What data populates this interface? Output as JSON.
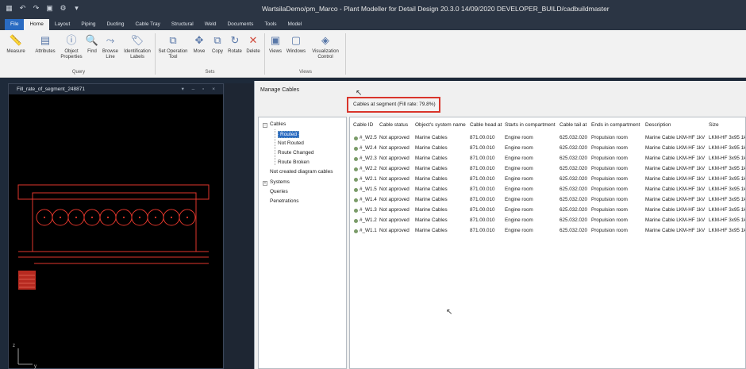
{
  "window": {
    "title": "WartsilaDemo/pm_Marco - Plant Modeller for Detail Design 20.3.0 14/09/2020 DEVELOPER_BUILD/cadbuildmaster"
  },
  "menu_tabs": [
    "File",
    "Home",
    "Layout",
    "Piping",
    "Ducting",
    "Cable Tray",
    "Structural",
    "Weld",
    "Documents",
    "Tools",
    "Model"
  ],
  "ribbon": {
    "buttons": [
      {
        "label": "Measure",
        "icon": "ruler-icon"
      },
      {
        "label": "Attributes",
        "icon": "attributes-icon"
      },
      {
        "label": "Object Properties",
        "icon": "info-icon"
      },
      {
        "label": "Find",
        "icon": "search-icon"
      },
      {
        "label": "Browse Line",
        "icon": "browse-line-icon"
      },
      {
        "label": "Identification Labels",
        "icon": "label-icon"
      },
      {
        "label": "Set Operation Tool",
        "icon": "set-operation-icon"
      },
      {
        "label": "Move",
        "icon": "move-icon"
      },
      {
        "label": "Copy",
        "icon": "copy-icon"
      },
      {
        "label": "Rotate",
        "icon": "rotate-icon"
      },
      {
        "label": "Delete",
        "icon": "delete-icon"
      },
      {
        "label": "Views",
        "icon": "views-icon"
      },
      {
        "label": "Windows",
        "icon": "windows-icon"
      },
      {
        "label": "Visualization Control",
        "icon": "visualization-icon"
      }
    ],
    "groups": [
      "Query",
      "Sets",
      "Views"
    ]
  },
  "viewer": {
    "title": "Fill_rate_of_segment_248871",
    "axis_z": "z",
    "axis_y": "y"
  },
  "dialog": {
    "title": "Manage Cables",
    "fill_rate_label": "Cables at segment (Fill rate: 79.8%)",
    "tree": {
      "cables": "Cables",
      "routed": "Routed",
      "not_routed": "Not Routed",
      "route_changed": "Route Changed",
      "route_broken": "Route Broken",
      "not_created": "Not created diagram cables",
      "systems": "Systems",
      "queries": "Queries",
      "penetrations": "Penetrations"
    },
    "columns": [
      "Cable ID",
      "Cable status",
      "Object's system name",
      "Cable head at",
      "Starts in compartment",
      "Cable tail at",
      "Ends in compartment",
      "Description",
      "Size"
    ],
    "rows": [
      [
        "#_W2.5",
        "Not approved",
        "Marine Cables",
        "871.00.010",
        "Engine room",
        "625.032.020",
        "Propulsion room",
        "Marine Cable LKM-HF 1kV",
        "LKM-HF 3x95 1k"
      ],
      [
        "#_W2.4",
        "Not approved",
        "Marine Cables",
        "871.00.010",
        "Engine room",
        "625.032.020",
        "Propulsion room",
        "Marine Cable LKM-HF 1kV",
        "LKM-HF 3x95 1k"
      ],
      [
        "#_W2.3",
        "Not approved",
        "Marine Cables",
        "871.00.010",
        "Engine room",
        "625.032.020",
        "Propulsion room",
        "Marine Cable LKM-HF 1kV",
        "LKM-HF 3x95 1k"
      ],
      [
        "#_W2.2",
        "Not approved",
        "Marine Cables",
        "871.00.010",
        "Engine room",
        "625.032.020",
        "Propulsion room",
        "Marine Cable LKM-HF 1kV",
        "LKM-HF 3x95 1k"
      ],
      [
        "#_W2.1",
        "Not approved",
        "Marine Cables",
        "871.00.010",
        "Engine room",
        "625.032.020",
        "Propulsion room",
        "Marine Cable LKM-HF 1kV",
        "LKM-HF 3x95 1k"
      ],
      [
        "#_W1.5",
        "Not approved",
        "Marine Cables",
        "871.00.010",
        "Engine room",
        "625.032.020",
        "Propulsion room",
        "Marine Cable LKM-HF 1kV",
        "LKM-HF 3x95 1k"
      ],
      [
        "#_W1.4",
        "Not approved",
        "Marine Cables",
        "871.00.010",
        "Engine room",
        "625.032.020",
        "Propulsion room",
        "Marine Cable LKM-HF 1kV",
        "LKM-HF 3x95 1k"
      ],
      [
        "#_W1.3",
        "Not approved",
        "Marine Cables",
        "871.00.010",
        "Engine room",
        "625.032.020",
        "Propulsion room",
        "Marine Cable LKM-HF 1kV",
        "LKM-HF 3x95 1k"
      ],
      [
        "#_W1.2",
        "Not approved",
        "Marine Cables",
        "871.00.010",
        "Engine room",
        "625.032.020",
        "Propulsion room",
        "Marine Cable LKM-HF 1kV",
        "LKM-HF 3x95 1k"
      ],
      [
        "#_W1.1",
        "Not approved",
        "Marine Cables",
        "871.00.010",
        "Engine room",
        "625.032.020",
        "Propulsion room",
        "Marine Cable LKM-HF 1kV",
        "LKM-HF 3x95 1k"
      ]
    ]
  },
  "colors": {
    "accent": "#2a6bc2",
    "highlight_border": "#d9352b",
    "cad_lines": "#e0362b"
  }
}
